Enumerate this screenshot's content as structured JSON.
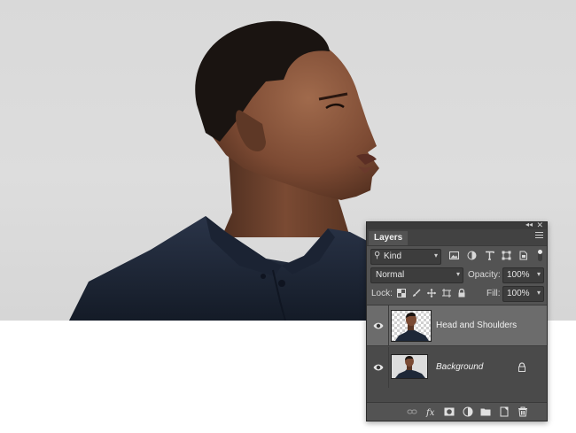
{
  "panel": {
    "tab_label": "Layers",
    "filter": {
      "kind_label": "Kind"
    },
    "blend_mode": "Normal",
    "opacity_label": "Opacity:",
    "opacity_value": "100%",
    "lock_label": "Lock:",
    "fill_label": "Fill:",
    "fill_value": "100%",
    "layers": [
      {
        "name": "Head and Shoulders",
        "selected": true,
        "visible": true,
        "locked": false
      },
      {
        "name": "Background",
        "selected": false,
        "visible": true,
        "locked": true
      }
    ],
    "filter_icons": [
      "image-filter-icon",
      "adjustment-filter-icon",
      "type-filter-icon",
      "shape-filter-icon",
      "smart-object-filter-icon"
    ],
    "lock_icons": [
      "lock-transparent-icon",
      "lock-image-icon",
      "lock-position-icon",
      "lock-artboard-icon",
      "lock-all-icon"
    ],
    "bottom_icons": [
      "link-layers-icon",
      "fx-icon",
      "add-mask-icon",
      "adjustment-layer-icon",
      "new-group-icon",
      "new-layer-icon",
      "delete-layer-icon"
    ],
    "colors": {
      "panel_bg": "#535353",
      "selected_row": "#6c6c6c",
      "field_bg": "#3d3d3d"
    }
  },
  "photo": {
    "subject": "profile-portrait",
    "background_color": "#dcdcdc",
    "shirt_color": "#1e2838"
  }
}
